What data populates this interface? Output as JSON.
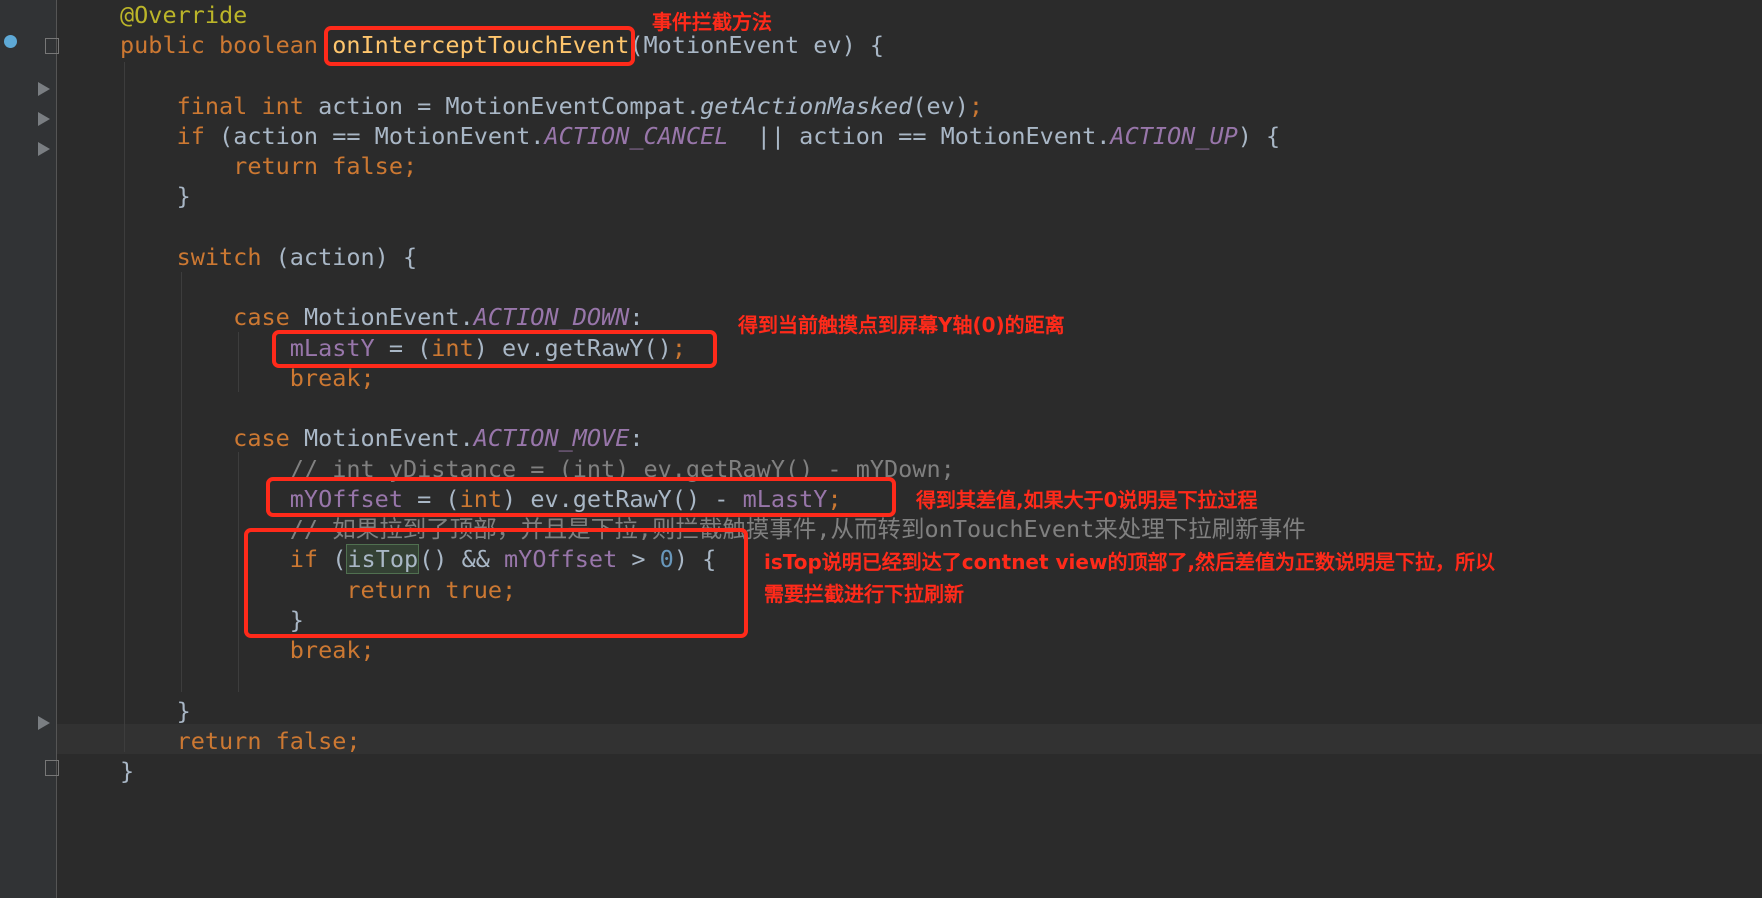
{
  "editor": {
    "colors": {
      "background": "#2b2b2b",
      "keyword": "#cc7832",
      "annotation_box": "#ff2a1a"
    },
    "lines": [
      [
        [
          "ann",
          "@Override"
        ]
      ],
      [
        [
          "kw",
          "public boolean "
        ],
        [
          "mth",
          "onInterceptTouchEvent"
        ],
        [
          "",
          "(MotionEvent ev) {"
        ]
      ],
      [],
      [
        [
          "kw",
          "    final int "
        ],
        [
          "",
          "action = MotionEventCompat."
        ],
        [
          "it",
          "getActionMasked"
        ],
        [
          "",
          "(ev)"
        ],
        [
          "kw",
          ";"
        ]
      ],
      [
        [
          "kw",
          "    if "
        ],
        [
          "",
          "(action == MotionEvent."
        ],
        [
          "fld",
          "ACTION_CANCEL"
        ],
        [
          "",
          ""
        ],
        [
          "",
          "  || action == MotionEvent."
        ],
        [
          "fld",
          "ACTION_UP"
        ],
        [
          "",
          ") {"
        ]
      ],
      [
        [
          "kw",
          "        return false;"
        ]
      ],
      [
        [
          "",
          "    }"
        ]
      ],
      [],
      [
        [
          "kw",
          "    switch "
        ],
        [
          "",
          "(action) {"
        ]
      ],
      [],
      [
        [
          "kw",
          "        case "
        ],
        [
          "",
          "MotionEvent."
        ],
        [
          "fld",
          "ACTION_DOWN"
        ],
        [
          "",
          ":"
        ]
      ],
      [
        [
          "var",
          "            mLastY "
        ],
        [
          "",
          "= ("
        ],
        [
          "kw",
          "int"
        ],
        [
          "",
          ") ev.getRawY()"
        ],
        [
          "kw",
          ";"
        ]
      ],
      [
        [
          "kw",
          "            break;"
        ]
      ],
      [],
      [
        [
          "kw",
          "        case "
        ],
        [
          "",
          "MotionEvent."
        ],
        [
          "fld",
          "ACTION_MOVE"
        ],
        [
          "",
          ":"
        ]
      ],
      [
        [
          "cmt",
          "            // int yDistance = (int) ev.getRawY() - mYDown;"
        ]
      ],
      [
        [
          "var",
          "            mYOffset "
        ],
        [
          "",
          "= ("
        ],
        [
          "kw",
          "int"
        ],
        [
          "",
          ") ev.getRawY() - "
        ],
        [
          "var",
          "mLastY"
        ],
        [
          "kw",
          ";"
        ]
      ],
      [
        [
          "cmt",
          "            // 如果拉到了顶部，并且是下拉,则拦截触摸事件,从而转到onTouchEvent来处理下拉刷新事件"
        ]
      ],
      [
        [
          "kw",
          "            if "
        ],
        [
          "",
          "("
        ],
        [
          "hl",
          "isTop"
        ],
        [
          "",
          "() && "
        ],
        [
          "var",
          "mYOffset "
        ],
        [
          "",
          "> "
        ],
        [
          "num",
          "0"
        ],
        [
          "",
          ") {"
        ]
      ],
      [
        [
          "kw",
          "                return true;"
        ]
      ],
      [
        [
          "",
          "            }"
        ]
      ],
      [
        [
          "kw",
          "            break;"
        ]
      ],
      [],
      [
        [
          "",
          "    }"
        ]
      ],
      [
        [
          "kw",
          "    return false;"
        ]
      ],
      [
        [
          "",
          "}"
        ]
      ]
    ]
  },
  "annotations": {
    "method": "事件拦截方法",
    "raw_y": "得到当前触摸点到屏幕Y轴(0)的距离",
    "offset": "得到其差值,如果大于0说明是下拉过程",
    "istop_1": "isTop说明已经到达了contnet view的顶部了,然后差值为正数说明是下拉，所以",
    "istop_2": "需要拦截进行下拉刷新"
  }
}
